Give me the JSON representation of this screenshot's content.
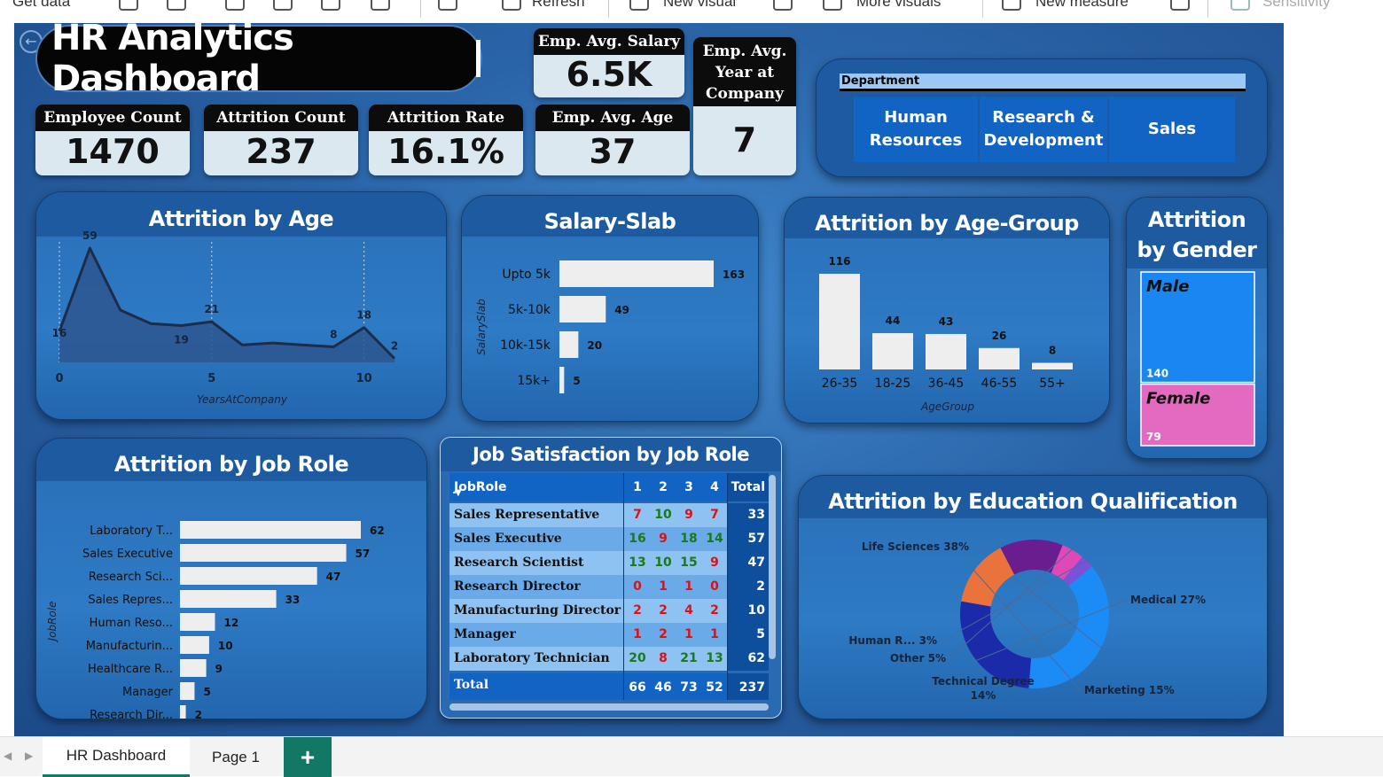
{
  "ribbon": {
    "items": [
      "Get data",
      "Refresh",
      "New visual",
      "More visuals",
      "New measure",
      "Sensitivity"
    ]
  },
  "header": {
    "title": "HR Analytics Dashboard"
  },
  "kpis": {
    "employee_count": {
      "label": "Employee Count",
      "value": "1470"
    },
    "attrition_count": {
      "label": "Attrition Count",
      "value": "237"
    },
    "attrition_rate": {
      "label": "Attrition Rate",
      "value": "16.1%"
    },
    "avg_salary": {
      "label": "Emp. Avg. Salary",
      "value": "6.5K"
    },
    "avg_age": {
      "label": "Emp. Avg. Age",
      "value": "37"
    },
    "avg_years": {
      "label_lines": [
        "Emp. Avg.",
        "Year at",
        "Company"
      ],
      "value": "7"
    }
  },
  "department_slicer": {
    "label": "Department",
    "options": [
      "Human Resources",
      "Research & Development",
      "Sales"
    ]
  },
  "colors": {
    "bar_fill": "#eeeeee",
    "male": "#1a86f2",
    "female": "#e46ac0",
    "donut": [
      "#1b8cf5",
      "#1a2aa8",
      "#e9733a",
      "#6a1d8e",
      "#e048b8",
      "#7a52d8"
    ],
    "positive_num": "#1a7a1a",
    "negative_num": "#e01010"
  },
  "chart_data": [
    {
      "id": "attrition_by_age",
      "type": "area",
      "title": "Attrition by Age",
      "xlabel": "YearsAtCompany",
      "ylabel": "",
      "x": [
        0,
        1,
        2,
        3,
        4,
        5,
        6,
        7,
        8,
        9,
        10,
        11
      ],
      "values": [
        16,
        59,
        27,
        20,
        19,
        21,
        9,
        10,
        9,
        8,
        18,
        2
      ],
      "data_labels": [
        {
          "x": 0,
          "text": "16"
        },
        {
          "x": 1,
          "text": "59"
        },
        {
          "x": 4,
          "text": "19"
        },
        {
          "x": 5,
          "text": "21"
        },
        {
          "x": 9,
          "text": "8"
        },
        {
          "x": 10,
          "text": "18"
        },
        {
          "x": 11,
          "text": "2"
        }
      ],
      "xticks": [
        "0",
        "5",
        "10"
      ],
      "xtick_values": [
        0,
        5,
        10
      ],
      "ylim": [
        0,
        65
      ]
    },
    {
      "id": "salary_slab",
      "type": "bar",
      "orientation": "horizontal",
      "title": "Salary-Slab",
      "ylabel": "SalarySlab",
      "categories": [
        "Upto 5k",
        "5k-10k",
        "10k-15k",
        "15k+"
      ],
      "values": [
        163,
        49,
        20,
        5
      ]
    },
    {
      "id": "attrition_by_age_group",
      "type": "bar",
      "title": "Attrition by Age-Group",
      "xlabel": "AgeGroup",
      "categories": [
        "26-35",
        "18-25",
        "36-45",
        "46-55",
        "55+"
      ],
      "values": [
        116,
        44,
        43,
        26,
        8
      ]
    },
    {
      "id": "attrition_by_gender",
      "type": "bar",
      "title_lines": [
        "Attrition",
        "by Gender"
      ],
      "categories": [
        "Male",
        "Female"
      ],
      "values": [
        140,
        79
      ]
    },
    {
      "id": "attrition_by_job_role",
      "type": "bar",
      "orientation": "horizontal",
      "title": "Attrition by Job Role",
      "ylabel": "JobRole",
      "categories": [
        "Laboratory T...",
        "Sales Executive",
        "Research Sci...",
        "Sales Repres...",
        "Human Reso...",
        "Manufacturin...",
        "Healthcare R...",
        "Manager",
        "Research Dir..."
      ],
      "values": [
        62,
        57,
        47,
        33,
        12,
        10,
        9,
        5,
        2
      ]
    },
    {
      "id": "job_satisfaction_by_job_role",
      "type": "table",
      "title": "Job Satisfaction by Job Role",
      "columns": [
        "JobRole",
        "1",
        "2",
        "3",
        "4",
        "Total"
      ],
      "rows": [
        {
          "role": "Sales Representative",
          "v": [
            7,
            10,
            9,
            7
          ],
          "total": 33
        },
        {
          "role": "Sales Executive",
          "v": [
            16,
            9,
            18,
            14
          ],
          "total": 57
        },
        {
          "role": "Research Scientist",
          "v": [
            13,
            10,
            15,
            9
          ],
          "total": 47
        },
        {
          "role": "Research Director",
          "v": [
            0,
            1,
            1,
            0
          ],
          "total": 2
        },
        {
          "role": "Manufacturing Director",
          "v": [
            2,
            2,
            4,
            2
          ],
          "total": 10
        },
        {
          "role": "Manager",
          "v": [
            1,
            2,
            1,
            1
          ],
          "total": 5
        },
        {
          "role": "Laboratory Technician",
          "v": [
            20,
            8,
            21,
            13
          ],
          "total": 62
        }
      ],
      "total_row": {
        "label": "Total",
        "v": [
          66,
          46,
          73,
          52
        ],
        "total": 237
      }
    },
    {
      "id": "attrition_by_education",
      "type": "pie",
      "donut": true,
      "title": "Attrition by Education Qualification",
      "slices": [
        {
          "label": "Life Sciences 38%",
          "value": 38
        },
        {
          "label": "Medical 27%",
          "value": 27
        },
        {
          "label": "Marketing 15%",
          "value": 15
        },
        {
          "label": "Technical Degree 14%",
          "value": 14
        },
        {
          "label": "Other 5%",
          "value": 5
        },
        {
          "label": "Human R... 3%",
          "value": 3
        }
      ]
    }
  ],
  "tabs": [
    "HR Dashboard",
    "Page 1"
  ],
  "add_tab_label": "+"
}
